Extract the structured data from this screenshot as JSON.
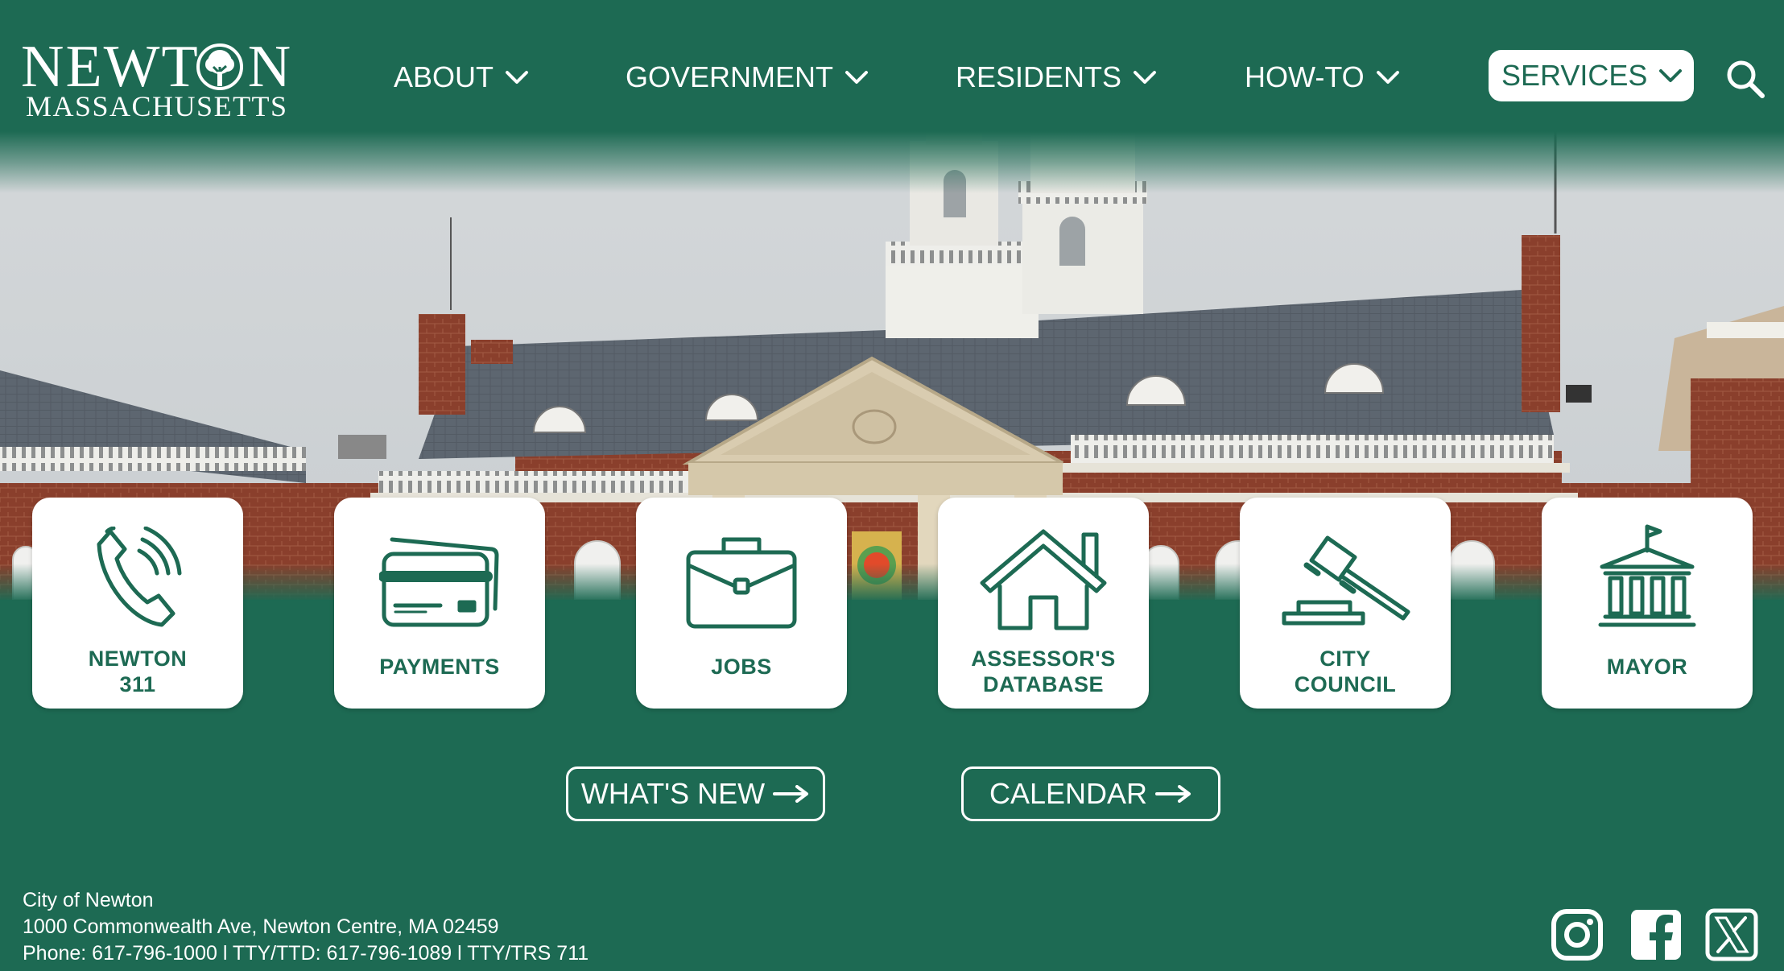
{
  "logo": {
    "name": "NEWTON",
    "name_left": "NEWT",
    "name_right": "N",
    "subtitle": "MASSACHUSETTS"
  },
  "nav": {
    "items": [
      {
        "label": "ABOUT"
      },
      {
        "label": "GOVERNMENT"
      },
      {
        "label": "RESIDENTS"
      },
      {
        "label": "HOW-TO"
      },
      {
        "label": "SERVICES",
        "active": true
      }
    ],
    "search_icon": "search-icon"
  },
  "tiles": [
    {
      "line1": "NEWTON",
      "line2": "311",
      "icon": "phone-icon"
    },
    {
      "line1": "PAYMENTS",
      "line2": "",
      "icon": "credit-card-icon"
    },
    {
      "line1": "JOBS",
      "line2": "",
      "icon": "briefcase-icon"
    },
    {
      "line1": "ASSESSOR'S",
      "line2": "DATABASE",
      "icon": "house-icon"
    },
    {
      "line1": "CITY",
      "line2": "COUNCIL",
      "icon": "gavel-icon"
    },
    {
      "line1": "MAYOR",
      "line2": "",
      "icon": "city-hall-icon"
    }
  ],
  "buttons": {
    "whats_new": "WHAT'S NEW",
    "calendar": "CALENDAR"
  },
  "footer": {
    "org": "City of Newton",
    "address": "1000 Commonwealth Ave, Newton Centre, MA 02459",
    "phone": "Phone: 617-796-1000 l TTY/TTD: 617-796-1089 l TTY/TRS 711"
  },
  "social": [
    "instagram-icon",
    "facebook-icon",
    "x-icon"
  ],
  "colors": {
    "brand_green": "#1d6a53",
    "white": "#ffffff"
  }
}
